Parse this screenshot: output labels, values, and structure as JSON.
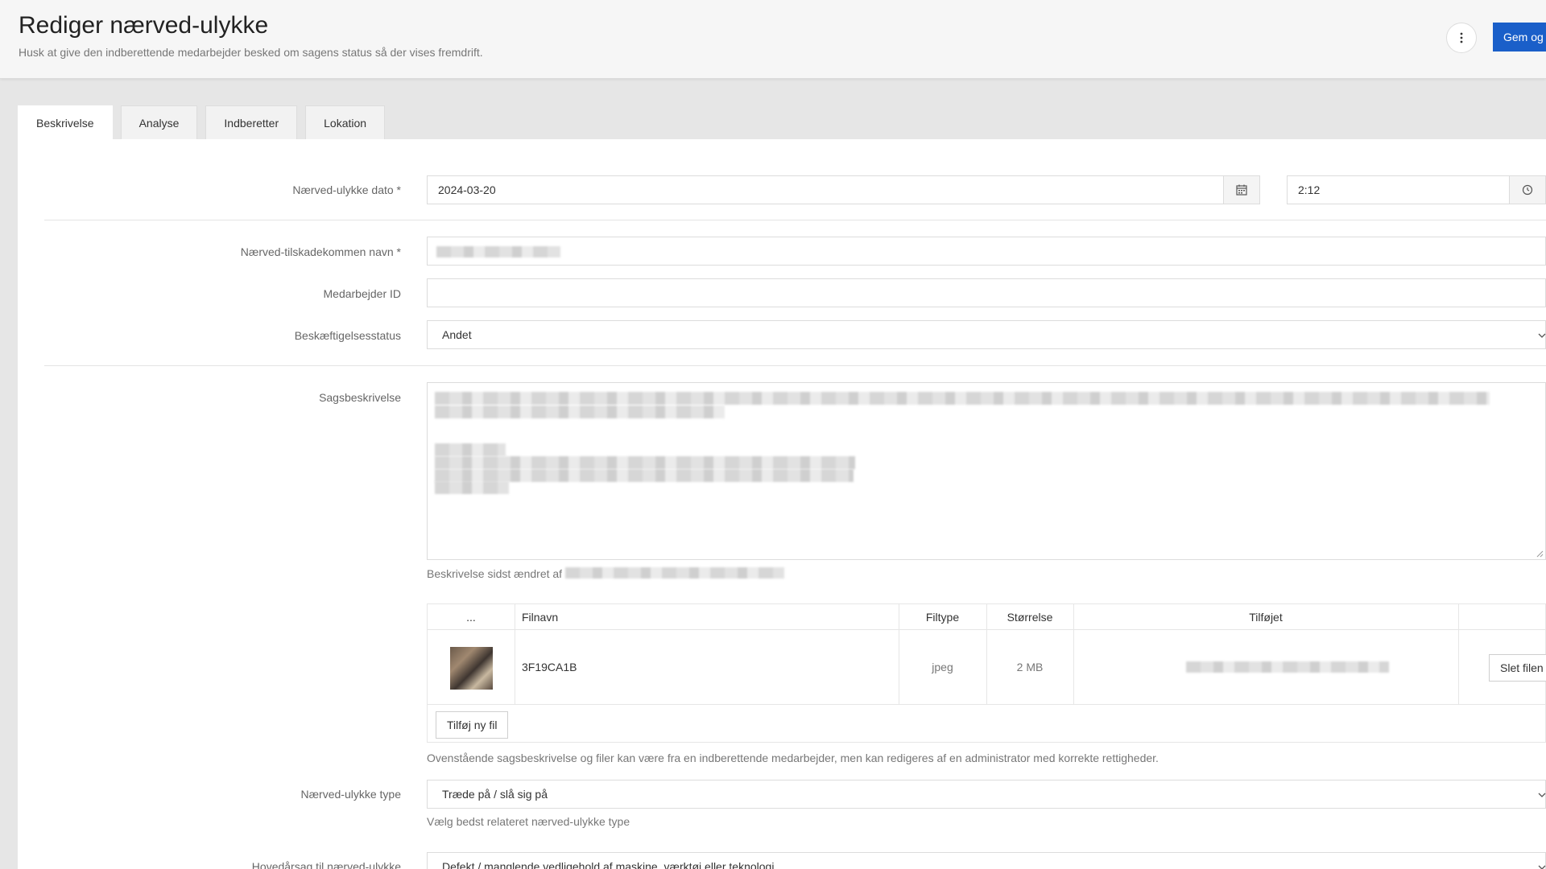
{
  "header": {
    "title": "Rediger nærved-ulykke",
    "subtitle": "Husk at give den indberettende medarbejder besked om sagens status så der vises fremdrift.",
    "more_icon": "more-vertical-icon",
    "save_label": "Gem og"
  },
  "tabs": [
    {
      "label": "Beskrivelse",
      "active": true
    },
    {
      "label": "Analyse",
      "active": false
    },
    {
      "label": "Indberetter",
      "active": false
    },
    {
      "label": "Lokation",
      "active": false
    }
  ],
  "form": {
    "date": {
      "label": "Nærved-ulykke dato *",
      "value": "2024-03-20",
      "icon": "calendar-icon"
    },
    "time": {
      "value": "2:12",
      "icon": "clock-icon"
    },
    "name": {
      "label": "Nærved-tilskadekommen navn *"
    },
    "employee_id": {
      "label": "Medarbejder ID",
      "value": ""
    },
    "employment_status": {
      "label": "Beskæftigelsesstatus",
      "value": "Andet"
    },
    "case_description": {
      "label": "Sagsbeskrivelse"
    },
    "last_changed_by": "Beskrivelse sidst ændret af",
    "files": {
      "columns": [
        "...",
        "Filnavn",
        "Filtype",
        "Størrelse",
        "Tilføjet"
      ],
      "rows": [
        {
          "name": "3F19CA1B",
          "type": "jpeg",
          "size": "2 MB",
          "delete_label": "Slet filen"
        }
      ],
      "add_label": "Tilføj ny fil"
    },
    "files_note": "Ovenstående sagsbeskrivelse og filer kan være fra en indberettende medarbejder, men kan redigeres af en administrator med korrekte rettigheder.",
    "incident_type": {
      "label": "Nærved-ulykke type",
      "value": "Træde på / slå sig på",
      "help": "Vælg bedst relateret nærved-ulykke type"
    },
    "main_cause": {
      "label": "Hovedårsag til nærved-ulykke",
      "value": "Defekt / manglende vedligehold af maskine, værktøj eller teknologi"
    }
  },
  "colors": {
    "primary": "#1a5fc9",
    "link": "#1ea5c8"
  }
}
